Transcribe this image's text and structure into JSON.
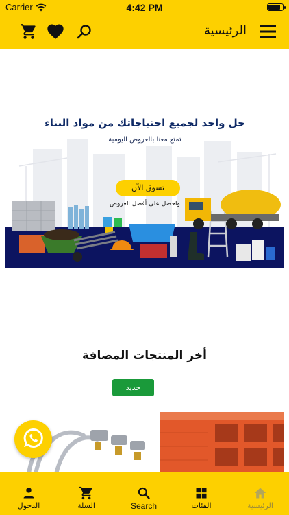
{
  "status_bar": {
    "carrier": "Carrier",
    "time": "4:42 PM",
    "battery_level": 0.9
  },
  "app_bar": {
    "title": "الرئيسية",
    "icons": [
      "menu-icon",
      "search-icon",
      "heart-icon",
      "cart-icon"
    ]
  },
  "banner": {
    "headline": "حل واحد لجميع احتياجاتك من مواد البناء",
    "subline": "تمتع معنا بالعروض اليومية",
    "cta_label": "تسوق الآن",
    "cta_note": "واحصل على أفضل العروض"
  },
  "latest_products": {
    "title": "أخر المنتجات المضافة",
    "badge": "جديد"
  },
  "bottom_nav": {
    "items": [
      {
        "label": "الدخول",
        "icon": "person-icon",
        "active": false
      },
      {
        "label": "السلة",
        "icon": "cart-icon",
        "active": false
      },
      {
        "label": "Search",
        "icon": "search-icon",
        "active": false
      },
      {
        "label": "الفئات",
        "icon": "grid-icon",
        "active": false
      },
      {
        "label": "الرئيسية",
        "icon": "home-icon",
        "active": true
      }
    ]
  },
  "colors": {
    "brand_yellow": "#fdd000",
    "navy": "#0f2a66",
    "badge_green": "#1a9a3a",
    "active_nav": "#9a8a3a"
  }
}
